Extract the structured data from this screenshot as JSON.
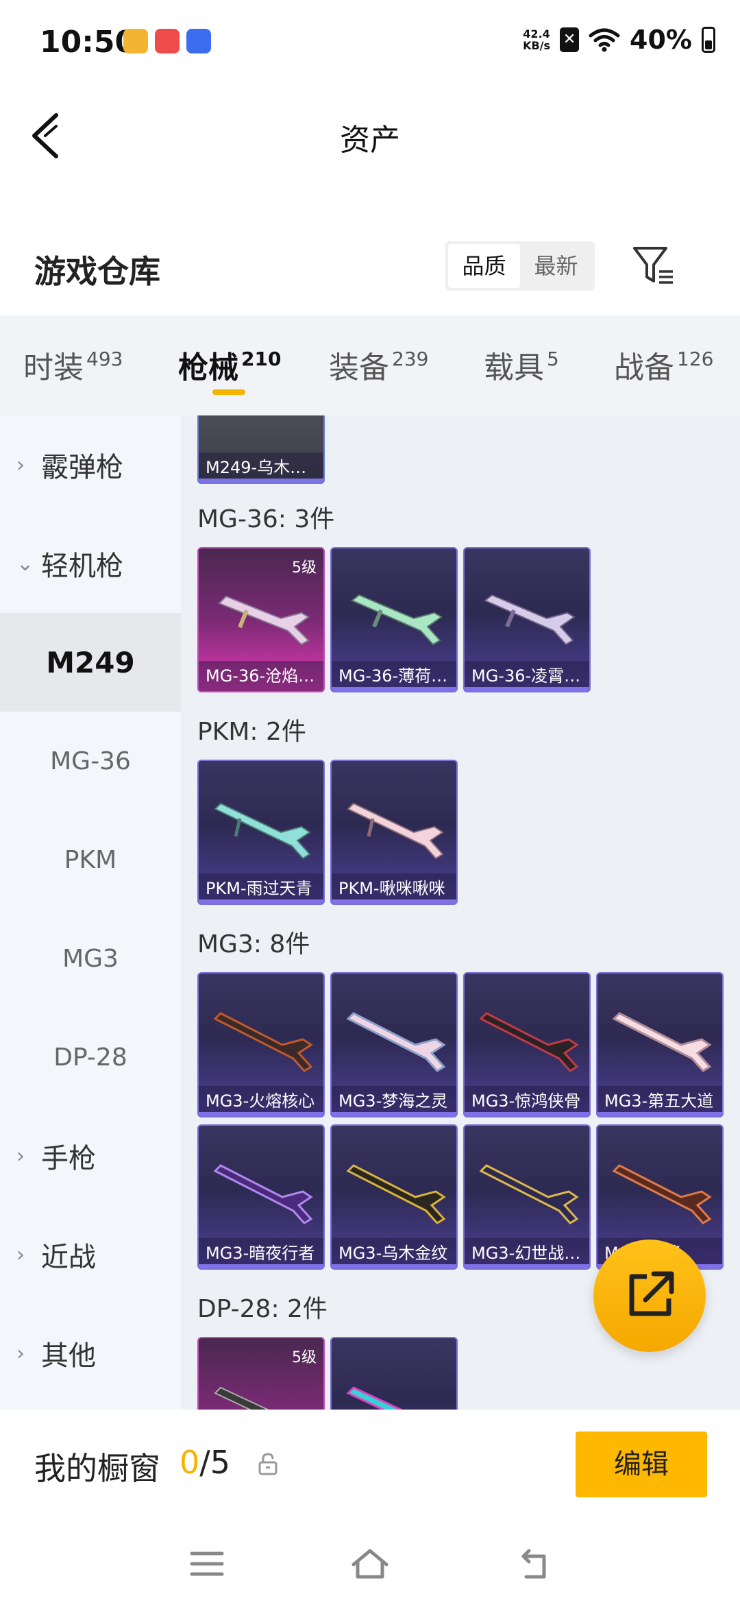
{
  "status_bar": {
    "time": "10:50",
    "net_speed_value": "42.4",
    "net_speed_unit": "KB/s",
    "sim_mark": "✕",
    "battery": "40%"
  },
  "header": {
    "title": "资产"
  },
  "section": {
    "title": "游戏仓库",
    "sort_options": [
      "品质",
      "最新"
    ],
    "active_sort": "品质"
  },
  "tabs": [
    {
      "label": "时装",
      "count": "493"
    },
    {
      "label": "枪械",
      "count": "210"
    },
    {
      "label": "装备",
      "count": "239"
    },
    {
      "label": "载具",
      "count": "5"
    },
    {
      "label": "战备",
      "count": "126"
    }
  ],
  "active_tab": "枪械",
  "sidebar": {
    "items": [
      {
        "label": "霰弹枪",
        "chev": "›"
      },
      {
        "label": "轻机枪",
        "chev": "⌄"
      },
      {
        "label": "M249"
      },
      {
        "label": "MG-36"
      },
      {
        "label": "PKM"
      },
      {
        "label": "MG3"
      },
      {
        "label": "DP-28"
      },
      {
        "label": "手枪",
        "chev": "›"
      },
      {
        "label": "近战",
        "chev": "›"
      },
      {
        "label": "其他",
        "chev": "›"
      }
    ],
    "selected": "M249"
  },
  "groups": {
    "m249_partial": {
      "name": "M249-乌木…"
    },
    "mg36": {
      "title": "MG-36: 3件",
      "items": [
        {
          "name": "MG-36-沧焰…",
          "level": "5级"
        },
        {
          "name": "MG-36-薄荷…"
        },
        {
          "name": "MG-36-凌霄…"
        }
      ]
    },
    "pkm": {
      "title": "PKM: 2件",
      "items": [
        {
          "name": "PKM-雨过天青"
        },
        {
          "name": "PKM-啾咪啾咪"
        }
      ]
    },
    "mg3": {
      "title": "MG3: 8件",
      "items": [
        {
          "name": "MG3-火熔核心"
        },
        {
          "name": "MG3-梦海之灵"
        },
        {
          "name": "MG3-惊鸿侠骨"
        },
        {
          "name": "MG3-第五大道"
        },
        {
          "name": "MG3-暗夜行者"
        },
        {
          "name": "MG3-乌木金纹"
        },
        {
          "name": "MG3-幻世战…"
        },
        {
          "name": "MG3-福将"
        }
      ]
    },
    "dp28": {
      "title": "DP-28: 2件",
      "items": [
        {
          "name": "",
          "level": "5级"
        },
        {
          "name": ""
        }
      ]
    }
  },
  "bottom": {
    "showcase_label": "我的橱窗",
    "showcase_current": "0",
    "showcase_total": "/5",
    "edit_label": "编辑"
  },
  "colors": {
    "accent": "#f5b400",
    "card_purple": "#3a3560",
    "card_gold": "#e23ab4"
  }
}
